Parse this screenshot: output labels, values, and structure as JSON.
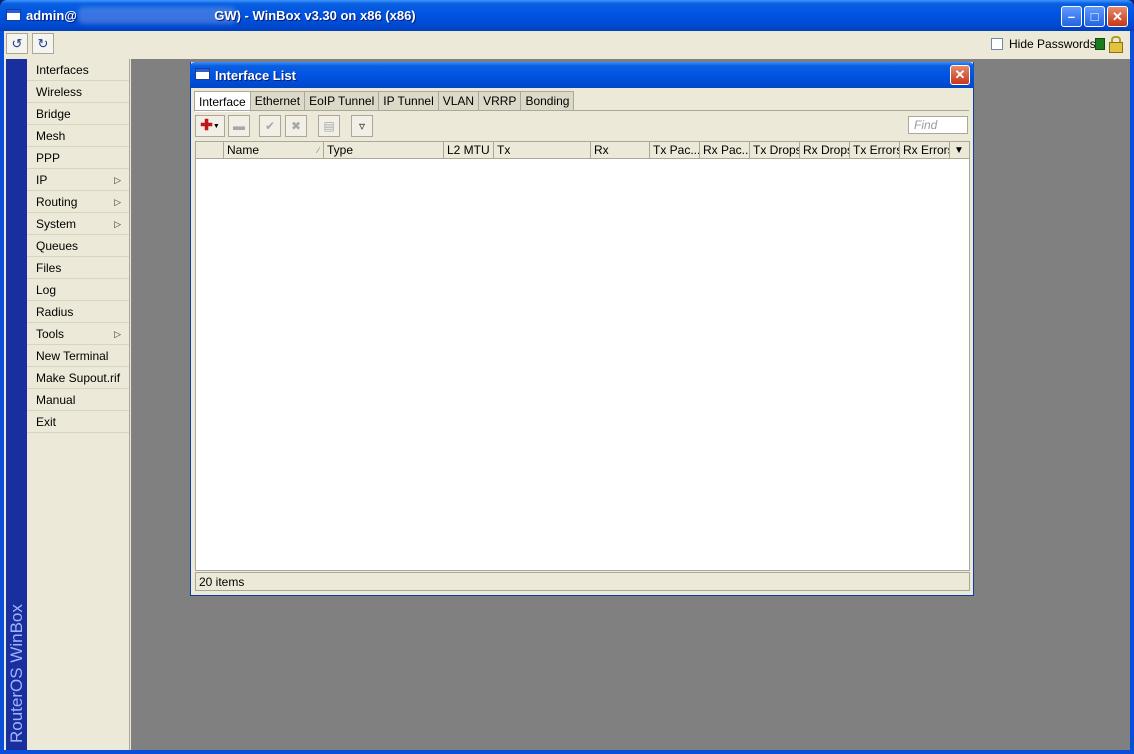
{
  "app": {
    "title": "admin@                                      GW) - WinBox v3.30 on x86 (x86)",
    "brand": "RouterOS WinBox"
  },
  "toolbar": {
    "undo_icon": "undo-icon",
    "redo_icon": "redo-icon",
    "hide_passwords_label": "Hide Passwords",
    "hide_passwords_checked": false
  },
  "menu": {
    "items": [
      {
        "label": "Interfaces",
        "submenu": false
      },
      {
        "label": "Wireless",
        "submenu": false
      },
      {
        "label": "Bridge",
        "submenu": false
      },
      {
        "label": "Mesh",
        "submenu": false
      },
      {
        "label": "PPP",
        "submenu": false
      },
      {
        "label": "IP",
        "submenu": true
      },
      {
        "label": "Routing",
        "submenu": true
      },
      {
        "label": "System",
        "submenu": true
      },
      {
        "label": "Queues",
        "submenu": false
      },
      {
        "label": "Files",
        "submenu": false
      },
      {
        "label": "Log",
        "submenu": false
      },
      {
        "label": "Radius",
        "submenu": false
      },
      {
        "label": "Tools",
        "submenu": true
      },
      {
        "label": "New Terminal",
        "submenu": false
      },
      {
        "label": "Make Supout.rif",
        "submenu": false
      },
      {
        "label": "Manual",
        "submenu": false
      },
      {
        "label": "Exit",
        "submenu": false
      }
    ]
  },
  "interface_window": {
    "title": "Interface List",
    "tabs": [
      "Interface",
      "Ethernet",
      "EoIP Tunnel",
      "IP Tunnel",
      "VLAN",
      "VRRP",
      "Bonding"
    ],
    "active_tab": "Interface",
    "find_placeholder": "Find",
    "columns": [
      "",
      "Name",
      "Type",
      "L2 MTU",
      "Tx",
      "Rx",
      "Tx Pac...",
      "Rx Pac...",
      "Tx Drops",
      "Rx Drops",
      "Tx Errors",
      "Rx Errors"
    ],
    "sorted_column": "Name",
    "rows": [],
    "status": "20 items"
  },
  "colors": {
    "title_bar": "#0054e3",
    "workspace": "#808080",
    "brand_bar": "#1a2f9e",
    "brand_text": "#9fb4ff"
  }
}
